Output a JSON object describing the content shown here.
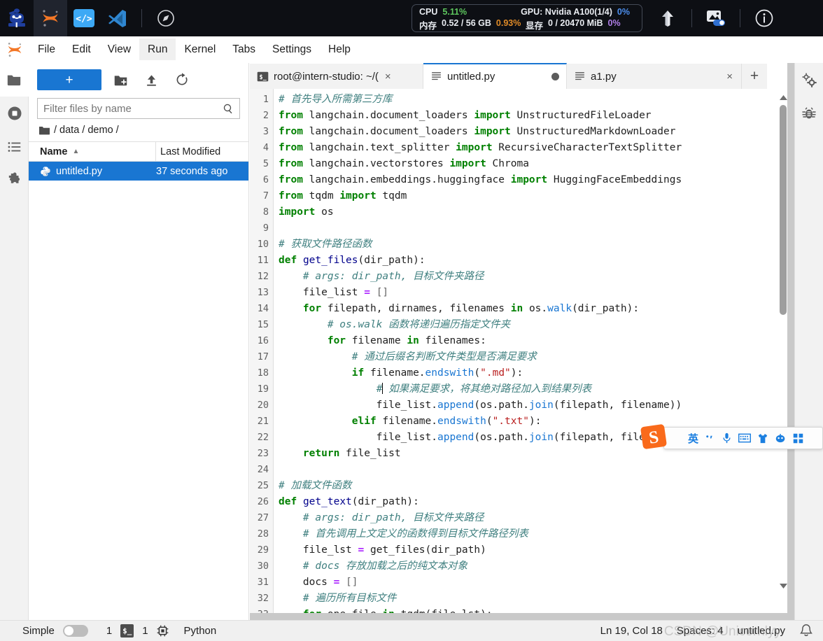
{
  "topbar": {
    "apps": [
      {
        "name": "intern-studio-logo",
        "label": "InternStudio"
      },
      {
        "name": "jupyter-logo",
        "label": "JupyterLab"
      },
      {
        "name": "code-server-icon",
        "label": "Code Server"
      },
      {
        "name": "vscode-icon",
        "label": "VS Code"
      },
      {
        "name": "compass-icon",
        "label": "Explore"
      }
    ],
    "system": {
      "cpu_label": "CPU",
      "cpu_value": "5.11%",
      "mem_label": "内存",
      "mem_value": "0.52 / 56 GB",
      "mem_percent": "0.93%",
      "gpu_label": "GPU: Nvidia A100(1/4)",
      "gpu_value": "0%",
      "vram_label": "显存",
      "vram_value": "0 / 20470 MiB",
      "vram_percent": "0%"
    },
    "right_icons": [
      {
        "name": "upload-arrow-icon",
        "label": "Upload"
      },
      {
        "name": "image-toggle-icon",
        "label": "Display"
      },
      {
        "name": "info-icon",
        "label": "Info"
      }
    ]
  },
  "menubar": {
    "items": [
      {
        "label": "File",
        "highlighted": false
      },
      {
        "label": "Edit",
        "highlighted": false
      },
      {
        "label": "View",
        "highlighted": false
      },
      {
        "label": "Run",
        "highlighted": true
      },
      {
        "label": "Kernel",
        "highlighted": false
      },
      {
        "label": "Tabs",
        "highlighted": false
      },
      {
        "label": "Settings",
        "highlighted": false
      },
      {
        "label": "Help",
        "highlighted": false
      }
    ]
  },
  "left_activity_bar": {
    "items": [
      {
        "name": "file-browser-icon",
        "label": "File Browser",
        "selected": true
      },
      {
        "name": "running-terminals-icon",
        "label": "Running Terminals and Kernels",
        "selected": false
      },
      {
        "name": "toc-list-icon",
        "label": "Table of Contents",
        "selected": false
      },
      {
        "name": "extension-puzzle-icon",
        "label": "Extension Manager",
        "selected": false
      }
    ]
  },
  "right_activity_bar": {
    "items": [
      {
        "name": "property-inspector-gears-icon",
        "label": "Property Inspector"
      },
      {
        "name": "debugger-bug-icon",
        "label": "Debugger"
      }
    ]
  },
  "file_browser": {
    "new_launcher_label": "+",
    "toolbar_icons": [
      {
        "name": "new-folder-icon",
        "label": "New Folder"
      },
      {
        "name": "upload-icon",
        "label": "Upload Files"
      },
      {
        "name": "refresh-icon",
        "label": "Refresh File List"
      }
    ],
    "filter_placeholder": "Filter files by name",
    "filter_value": "",
    "breadcrumb": [
      "/",
      "data",
      "/",
      "demo",
      "/"
    ],
    "breadcrumb_text": "/ data / demo /",
    "columns": [
      "Name",
      "Last Modified"
    ],
    "sort_indicator": "▲",
    "rows": [
      {
        "icon": "python-file-icon",
        "name": "untitled.py",
        "modified": "37 seconds ago",
        "selected": true
      }
    ]
  },
  "tabs": [
    {
      "icon": "terminal-icon",
      "label": "root@intern-studio: ~/(",
      "close": "×",
      "active": false,
      "dirty": false
    },
    {
      "icon": "text-file-icon",
      "label": "untitled.py",
      "dirty": true,
      "active": true
    },
    {
      "icon": "text-file-icon",
      "label": "a1.py",
      "close": "×",
      "active": false,
      "dirty": false
    }
  ],
  "tab_add_label": "+",
  "editor": {
    "first_line_number": 1,
    "lines": [
      {
        "n": 1,
        "tokens": [
          {
            "t": "# 首先导入所需第三方库",
            "c": "cm"
          }
        ]
      },
      {
        "n": 2,
        "tokens": [
          {
            "t": "from",
            "c": "k"
          },
          {
            "t": " langchain.document_loaders ",
            "c": ""
          },
          {
            "t": "import",
            "c": "k"
          },
          {
            "t": " UnstructuredFileLoader",
            "c": ""
          }
        ]
      },
      {
        "n": 3,
        "tokens": [
          {
            "t": "from",
            "c": "k"
          },
          {
            "t": " langchain.document_loaders ",
            "c": ""
          },
          {
            "t": "import",
            "c": "k"
          },
          {
            "t": " UnstructuredMarkdownLoader",
            "c": ""
          }
        ]
      },
      {
        "n": 4,
        "tokens": [
          {
            "t": "from",
            "c": "k"
          },
          {
            "t": " langchain.text_splitter ",
            "c": ""
          },
          {
            "t": "import",
            "c": "k"
          },
          {
            "t": " RecursiveCharacterTextSplitter",
            "c": ""
          }
        ]
      },
      {
        "n": 5,
        "tokens": [
          {
            "t": "from",
            "c": "k"
          },
          {
            "t": " langchain.vectorstores ",
            "c": ""
          },
          {
            "t": "import",
            "c": "k"
          },
          {
            "t": " Chroma",
            "c": ""
          }
        ]
      },
      {
        "n": 6,
        "tokens": [
          {
            "t": "from",
            "c": "k"
          },
          {
            "t": " langchain.embeddings.huggingface ",
            "c": ""
          },
          {
            "t": "import",
            "c": "k"
          },
          {
            "t": " HuggingFaceEmbeddings",
            "c": ""
          }
        ]
      },
      {
        "n": 7,
        "tokens": [
          {
            "t": "from",
            "c": "k"
          },
          {
            "t": " tqdm ",
            "c": ""
          },
          {
            "t": "import",
            "c": "k"
          },
          {
            "t": " tqdm",
            "c": ""
          }
        ]
      },
      {
        "n": 8,
        "tokens": [
          {
            "t": "import",
            "c": "k"
          },
          {
            "t": " os",
            "c": ""
          }
        ]
      },
      {
        "n": 9,
        "tokens": []
      },
      {
        "n": 10,
        "tokens": [
          {
            "t": "# 获取文件路径函数",
            "c": "cm"
          }
        ]
      },
      {
        "n": 11,
        "tokens": [
          {
            "t": "def",
            "c": "k"
          },
          {
            "t": " ",
            "c": ""
          },
          {
            "t": "get_files",
            "c": "fn"
          },
          {
            "t": "(dir_path):",
            "c": ""
          }
        ]
      },
      {
        "n": 12,
        "tokens": [
          {
            "t": "    ",
            "c": ""
          },
          {
            "t": "# args: dir_path, 目标文件夹路径",
            "c": "cm"
          }
        ]
      },
      {
        "n": 13,
        "tokens": [
          {
            "t": "    file_list ",
            "c": ""
          },
          {
            "t": "=",
            "c": "op"
          },
          {
            "t": " ",
            "c": ""
          },
          {
            "t": "[]",
            "c": "pn"
          }
        ]
      },
      {
        "n": 14,
        "tokens": [
          {
            "t": "    ",
            "c": ""
          },
          {
            "t": "for",
            "c": "k"
          },
          {
            "t": " filepath, dirnames, filenames ",
            "c": ""
          },
          {
            "t": "in",
            "c": "k"
          },
          {
            "t": " os.",
            "c": ""
          },
          {
            "t": "walk",
            "c": "bi"
          },
          {
            "t": "(dir_path):",
            "c": ""
          }
        ]
      },
      {
        "n": 15,
        "tokens": [
          {
            "t": "        ",
            "c": ""
          },
          {
            "t": "# os.walk 函数将递归遍历指定文件夹",
            "c": "cm"
          }
        ]
      },
      {
        "n": 16,
        "tokens": [
          {
            "t": "        ",
            "c": ""
          },
          {
            "t": "for",
            "c": "k"
          },
          {
            "t": " filename ",
            "c": ""
          },
          {
            "t": "in",
            "c": "k"
          },
          {
            "t": " filenames:",
            "c": ""
          }
        ]
      },
      {
        "n": 17,
        "tokens": [
          {
            "t": "            ",
            "c": ""
          },
          {
            "t": "# 通过后缀名判断文件类型是否满足要求",
            "c": "cm"
          }
        ]
      },
      {
        "n": 18,
        "tokens": [
          {
            "t": "            ",
            "c": ""
          },
          {
            "t": "if",
            "c": "k"
          },
          {
            "t": " filename.",
            "c": ""
          },
          {
            "t": "endswith",
            "c": "bi"
          },
          {
            "t": "(",
            "c": ""
          },
          {
            "t": "\".md\"",
            "c": "st"
          },
          {
            "t": "):",
            "c": ""
          }
        ]
      },
      {
        "n": 19,
        "tokens": [
          {
            "t": "                ",
            "c": ""
          },
          {
            "t": "#",
            "c": "cm"
          },
          {
            "t": "CURSOR",
            "c": "cursor"
          },
          {
            "t": " 如果满足要求，将其绝对路径加入到结果列表",
            "c": "cm"
          }
        ]
      },
      {
        "n": 20,
        "tokens": [
          {
            "t": "                file_list.",
            "c": ""
          },
          {
            "t": "append",
            "c": "bi"
          },
          {
            "t": "(os.path.",
            "c": ""
          },
          {
            "t": "join",
            "c": "bi"
          },
          {
            "t": "(filepath, filename))",
            "c": ""
          }
        ]
      },
      {
        "n": 21,
        "tokens": [
          {
            "t": "            ",
            "c": ""
          },
          {
            "t": "elif",
            "c": "k"
          },
          {
            "t": " filename.",
            "c": ""
          },
          {
            "t": "endswith",
            "c": "bi"
          },
          {
            "t": "(",
            "c": ""
          },
          {
            "t": "\".txt\"",
            "c": "st"
          },
          {
            "t": "):",
            "c": ""
          }
        ]
      },
      {
        "n": 22,
        "tokens": [
          {
            "t": "                file_list.",
            "c": ""
          },
          {
            "t": "append",
            "c": "bi"
          },
          {
            "t": "(os.path.",
            "c": ""
          },
          {
            "t": "join",
            "c": "bi"
          },
          {
            "t": "(filepath, filename))",
            "c": ""
          }
        ]
      },
      {
        "n": 23,
        "tokens": [
          {
            "t": "    ",
            "c": ""
          },
          {
            "t": "return",
            "c": "k"
          },
          {
            "t": " file_list",
            "c": ""
          }
        ]
      },
      {
        "n": 24,
        "tokens": []
      },
      {
        "n": 25,
        "tokens": [
          {
            "t": "# 加载文件函数",
            "c": "cm"
          }
        ]
      },
      {
        "n": 26,
        "tokens": [
          {
            "t": "def",
            "c": "k"
          },
          {
            "t": " ",
            "c": ""
          },
          {
            "t": "get_text",
            "c": "fn"
          },
          {
            "t": "(dir_path):",
            "c": ""
          }
        ]
      },
      {
        "n": 27,
        "tokens": [
          {
            "t": "    ",
            "c": ""
          },
          {
            "t": "# args: dir_path, 目标文件夹路径",
            "c": "cm"
          }
        ]
      },
      {
        "n": 28,
        "tokens": [
          {
            "t": "    ",
            "c": ""
          },
          {
            "t": "# 首先调用上文定义的函数得到目标文件路径列表",
            "c": "cm"
          }
        ]
      },
      {
        "n": 29,
        "tokens": [
          {
            "t": "    file_lst ",
            "c": ""
          },
          {
            "t": "=",
            "c": "op"
          },
          {
            "t": " ",
            "c": ""
          },
          {
            "t": "get_files",
            "c": ""
          },
          {
            "t": "(dir_path)",
            "c": ""
          }
        ]
      },
      {
        "n": 30,
        "tokens": [
          {
            "t": "    ",
            "c": ""
          },
          {
            "t": "# docs 存放加载之后的纯文本对象",
            "c": "cm"
          }
        ]
      },
      {
        "n": 31,
        "tokens": [
          {
            "t": "    docs ",
            "c": ""
          },
          {
            "t": "=",
            "c": "op"
          },
          {
            "t": " ",
            "c": ""
          },
          {
            "t": "[]",
            "c": "pn"
          }
        ]
      },
      {
        "n": 32,
        "tokens": [
          {
            "t": "    ",
            "c": ""
          },
          {
            "t": "# 遍历所有目标文件",
            "c": "cm"
          }
        ]
      },
      {
        "n": 33,
        "tokens": [
          {
            "t": "    ",
            "c": ""
          },
          {
            "t": "for",
            "c": "k"
          },
          {
            "t": " one_file ",
            "c": ""
          },
          {
            "t": "in",
            "c": "k"
          },
          {
            "t": " tqdm(file_lst):",
            "c": ""
          }
        ]
      }
    ]
  },
  "statusbar": {
    "simple_label": "Simple",
    "simple_on": false,
    "kernel_count": "1",
    "terminal_badge": "$_",
    "terminal_count": "1",
    "kernel_name": "Python",
    "cursor_position": "Ln 19, Col 18",
    "spaces": "Spaces: 4",
    "filename": "untitled.py",
    "notification_icon": "bell-icon"
  },
  "ime": {
    "logo": "sogou-logo",
    "mode_label": "英",
    "icons": [
      {
        "name": "punctuation-icon",
        "glyph": "·,"
      },
      {
        "name": "microphone-icon",
        "glyph": "🎤"
      },
      {
        "name": "keyboard-icon",
        "glyph": "⌨"
      },
      {
        "name": "skin-shirt-icon",
        "glyph": "👕"
      },
      {
        "name": "emoji-face-icon",
        "glyph": "☻"
      },
      {
        "name": "toolbox-grid-icon",
        "glyph": "▦"
      }
    ]
  },
  "watermark": "CSDN @Unicornlyy",
  "colors": {
    "accent": "#1976d2",
    "topbar_bg": "#0d0f14",
    "panel_bg": "#f2f2f2",
    "keyword": "#008000",
    "comment": "#408080",
    "string": "#ba2121",
    "builtin": "#1976d2",
    "operator": "#aa22ff"
  }
}
